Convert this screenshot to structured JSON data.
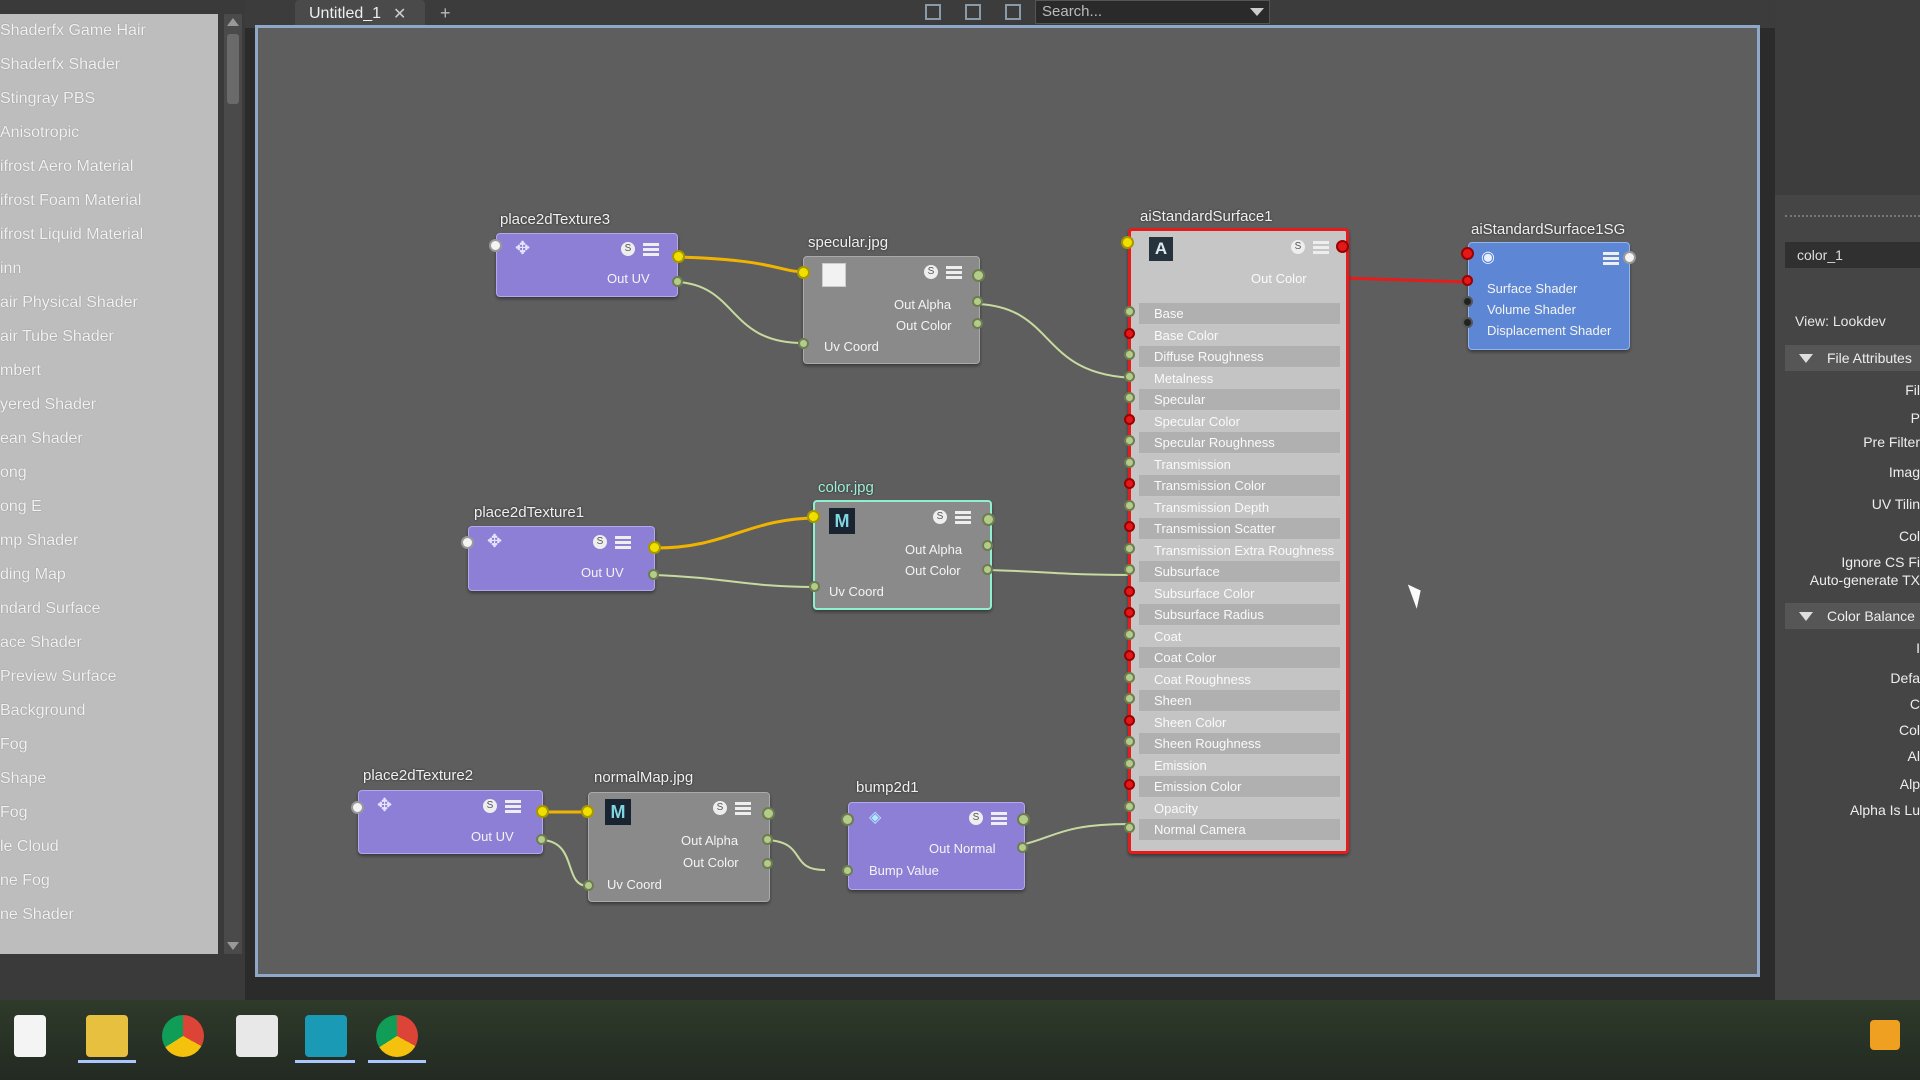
{
  "shader_list": {
    "items": [
      "Shaderfx Game Hair",
      "Shaderfx Shader",
      "Stingray PBS",
      "Anisotropic",
      "ifrost Aero Material",
      "ifrost Foam Material",
      "ifrost Liquid Material",
      "inn",
      "air Physical Shader",
      "air Tube Shader",
      "mbert",
      "yered Shader",
      "ean Shader",
      "ong",
      "ong E",
      "mp Shader",
      "ding Map",
      "ndard Surface",
      "ace Shader",
      "Preview Surface",
      "Background",
      "Fog",
      "Shape",
      "Fog",
      "le Cloud",
      "ne Fog",
      "ne Shader"
    ]
  },
  "tabs": {
    "active": "Untitled_1",
    "close": "✕",
    "add": "+"
  },
  "search": {
    "placeholder": "Search..."
  },
  "nodes": {
    "place2dTexture3": {
      "title": "place2dTexture3",
      "out": "Out UV"
    },
    "specular": {
      "title": "specular.jpg",
      "out_alpha": "Out Alpha",
      "out_color": "Out Color",
      "uv": "Uv Coord"
    },
    "place2dTexture1": {
      "title": "place2dTexture1",
      "out": "Out UV"
    },
    "color": {
      "title": "color.jpg",
      "out_alpha": "Out Alpha",
      "out_color": "Out Color",
      "uv": "Uv Coord",
      "icon": "M"
    },
    "place2dTexture2": {
      "title": "place2dTexture2",
      "out": "Out UV"
    },
    "normalMap": {
      "title": "normalMap.jpg",
      "out_alpha": "Out Alpha",
      "out_color": "Out Color",
      "uv": "Uv Coord",
      "icon": "M"
    },
    "bump2d1": {
      "title": "bump2d1",
      "out": "Out Normal",
      "bump": "Bump Value"
    },
    "aiStandardSurface1": {
      "title": "aiStandardSurface1",
      "icon": "A",
      "out": "Out Color",
      "attributes": [
        "Base",
        "Base Color",
        "Diffuse Roughness",
        "Metalness",
        "Specular",
        "Specular Color",
        "Specular Roughness",
        "Transmission",
        "Transmission Color",
        "Transmission Depth",
        "Transmission Scatter",
        "Transmission Extra Roughness",
        "Subsurface",
        "Subsurface Color",
        "Subsurface Radius",
        "Coat",
        "Coat Color",
        "Coat Roughness",
        "Sheen",
        "Sheen Color",
        "Sheen Roughness",
        "Emission",
        "Emission Color",
        "Opacity",
        "Normal Camera"
      ]
    },
    "aiStandardSurface1SG": {
      "title": "aiStandardSurface1SG",
      "inputs": [
        "Surface Shader",
        "Volume Shader",
        "Displacement Shader"
      ]
    }
  },
  "badge_s": "S",
  "right_panel": {
    "field": "color_1",
    "view": "View: Lookdev",
    "file_attributes": "File Attributes",
    "attr_labels": [
      "Fil",
      "P",
      "Pre Filter",
      "Imag",
      "UV Tilin",
      "Col",
      "Ignore CS Fi",
      "Auto-generate TX"
    ],
    "color_balance": "Color Balance",
    "cb_labels": [
      "I",
      "Defa",
      "C",
      "Col",
      "Al",
      "Alp",
      "Alpha Is Lu"
    ]
  },
  "colors": {
    "accent_red": "#e31c1c",
    "wire_yellow": "#f0b400",
    "wire_green": "#c7dba0",
    "node_purple": "#8e7fd6",
    "sg_blue": "#5d86d4"
  }
}
